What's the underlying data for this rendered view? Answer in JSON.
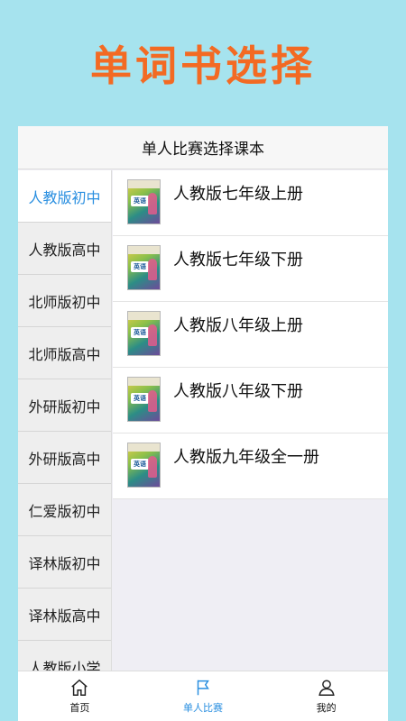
{
  "banner": {
    "title": "单词书选择"
  },
  "panel": {
    "title": "单人比赛选择课本"
  },
  "sidebar": {
    "items": [
      {
        "label": "人教版初中",
        "active": true
      },
      {
        "label": "人教版高中",
        "active": false
      },
      {
        "label": "北师版初中",
        "active": false
      },
      {
        "label": "北师版高中",
        "active": false
      },
      {
        "label": "外研版初中",
        "active": false
      },
      {
        "label": "外研版高中",
        "active": false
      },
      {
        "label": "仁爱版初中",
        "active": false
      },
      {
        "label": "译林版初中",
        "active": false
      },
      {
        "label": "译林版高中",
        "active": false
      },
      {
        "label": "人教版小学",
        "active": false
      }
    ]
  },
  "books": [
    {
      "title": "人教版七年级上册",
      "cover_tag": "英语"
    },
    {
      "title": "人教版七年级下册",
      "cover_tag": "英语"
    },
    {
      "title": "人教版八年级上册",
      "cover_tag": "英语"
    },
    {
      "title": "人教版八年级下册",
      "cover_tag": "英语"
    },
    {
      "title": "人教版九年级全一册",
      "cover_tag": "英语"
    }
  ],
  "tabbar": {
    "home_label": "首页",
    "single_label": "单人比赛",
    "mine_label": "我的"
  },
  "colors": {
    "background": "#a6e3ee",
    "title": "#f36a23",
    "accent": "#2a8fe0"
  }
}
